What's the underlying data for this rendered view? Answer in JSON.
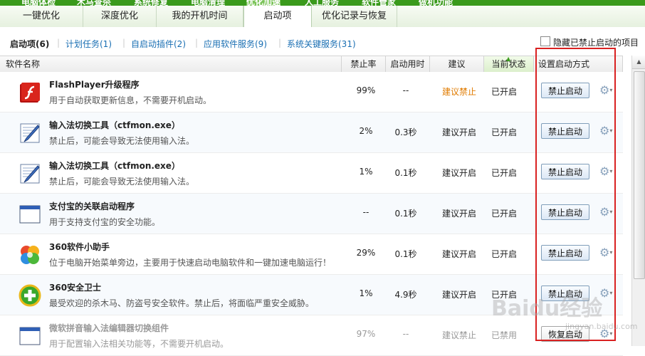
{
  "top_nav": [
    "电脑体检",
    "木马查杀",
    "系统修复",
    "电脑清理",
    "优化加速",
    "人工服务",
    "软件管家",
    "做机功能"
  ],
  "tabs": [
    {
      "label": "一键优化"
    },
    {
      "label": "深度优化"
    },
    {
      "label": "我的开机时间"
    },
    {
      "label": "启动项",
      "active": true
    },
    {
      "label": "优化记录与恢复"
    }
  ],
  "subnav": {
    "items": [
      "启动项(6)",
      "计划任务(1)",
      "自启动插件(2)",
      "应用软件服务(9)",
      "系统关键服务(31)"
    ],
    "hide_disabled_label": "隐藏已禁止启动的项目"
  },
  "columns": {
    "name": "软件名称",
    "rate": "禁止率",
    "time": "启动用时",
    "suggestion": "建议",
    "state": "当前状态",
    "action": "设置启动方式"
  },
  "rows": [
    {
      "icon": "flash-player-icon",
      "name": "FlashPlayer升级程序",
      "desc": "用于自动获取更新信息，不需要开机启动。",
      "rate": "99%",
      "time": "--",
      "suggestion": "建议禁止",
      "suggestion_color": "#e07b00",
      "state": "已开启",
      "button": "禁止启动"
    },
    {
      "icon": "pen-edit-icon",
      "name": "输入法切换工具（ctfmon.exe）",
      "desc": "禁止后，可能会导致无法使用输入法。",
      "rate": "2%",
      "time": "0.3秒",
      "suggestion": "建议开启",
      "state": "已开启",
      "button": "禁止启动"
    },
    {
      "icon": "pen-edit-icon",
      "name": "输入法切换工具（ctfmon.exe）",
      "desc": "禁止后，可能会导致无法使用输入法。",
      "rate": "1%",
      "time": "0.1秒",
      "suggestion": "建议开启",
      "state": "已开启",
      "button": "禁止启动"
    },
    {
      "icon": "window-app-icon",
      "name": "支付宝的关联启动程序",
      "desc": "用于支持支付宝的安全功能。",
      "rate": "--",
      "time": "0.1秒",
      "suggestion": "建议开启",
      "state": "已开启",
      "button": "禁止启动"
    },
    {
      "icon": "360-assistant-icon",
      "name": "360软件小助手",
      "desc": "位于电脑开始菜单旁边，主要用于快速启动电脑软件和一键加速电脑运行！",
      "rate": "29%",
      "time": "0.1秒",
      "suggestion": "建议开启",
      "state": "已开启",
      "button": "禁止启动"
    },
    {
      "icon": "360-safe-guard-icon",
      "name": "360安全卫士",
      "desc": "最受欢迎的杀木马、防盗号安全软件。禁止后，将面临严重安全威胁。",
      "rate": "1%",
      "time": "4.9秒",
      "suggestion": "建议开启",
      "state": "已开启",
      "button": "禁止启动"
    },
    {
      "icon": "window-app-icon",
      "name": "微软拼音输入法编辑器切换组件",
      "desc": "用于配置输入法相关功能等，不需要开机启动。",
      "rate": "97%",
      "time": "--",
      "suggestion": "建议禁止",
      "state": "已禁用",
      "button": "恢复启动",
      "disabled": true
    }
  ],
  "watermark": {
    "main": "Baidu经验",
    "sub": "jingyan.baidu.com"
  }
}
